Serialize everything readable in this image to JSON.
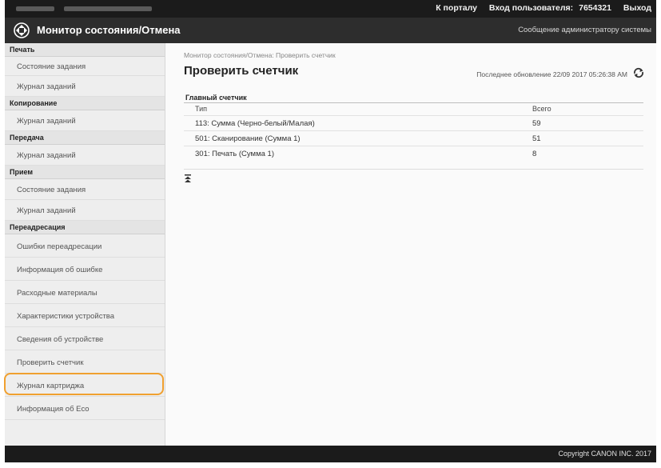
{
  "topbar": {
    "portal_link": "К порталу",
    "login_label": "Вход пользователя:",
    "user_id": "7654321",
    "logout_link": "Выход"
  },
  "header": {
    "title": "Монитор состояния/Отмена",
    "admin_message_link": "Сообщение администратору системы"
  },
  "sidebar": {
    "sections": [
      {
        "heading": "Печать",
        "items": [
          "Состояние задания",
          "Журнал заданий"
        ]
      },
      {
        "heading": "Копирование",
        "items": [
          "Журнал заданий"
        ]
      },
      {
        "heading": "Передача",
        "items": [
          "Журнал заданий"
        ]
      },
      {
        "heading": "Прием",
        "items": [
          "Состояние задания",
          "Журнал заданий"
        ]
      },
      {
        "heading": "Переадресация",
        "items": [
          "Ошибки переадресации"
        ]
      }
    ],
    "device_items": [
      "Информация об ошибке",
      "Расходные материалы",
      "Характеристики устройства",
      "Сведения об устройстве",
      "Проверить счетчик",
      "Журнал картриджа",
      "Информация об Eco"
    ],
    "selected_item": "Проверить счетчик"
  },
  "main": {
    "breadcrumb": "Монитор состояния/Отмена: Проверить счетчик",
    "page_title": "Проверить счетчик",
    "last_update": "Последнее обновление 22/09 2017 05:26:38 AM",
    "table": {
      "caption": "Главный счетчик",
      "col_type": "Тип",
      "col_total": "Всего",
      "rows": [
        {
          "type": "113: Сумма (Черно-белый/Малая)",
          "total": "59"
        },
        {
          "type": "501: Сканирование (Сумма 1)",
          "total": "51"
        },
        {
          "type": "301: Печать (Сумма 1)",
          "total": "8"
        }
      ]
    }
  },
  "footer": {
    "copyright": "Copyright CANON INC. 2017"
  },
  "icons": {
    "logo": "monitor-logo-icon",
    "refresh": "refresh-icon",
    "to_top": "to-top-icon"
  },
  "colors": {
    "highlight": "#f0a030",
    "header_bg": "#2d2d2d",
    "topbar_bg": "#1b1b1b"
  }
}
